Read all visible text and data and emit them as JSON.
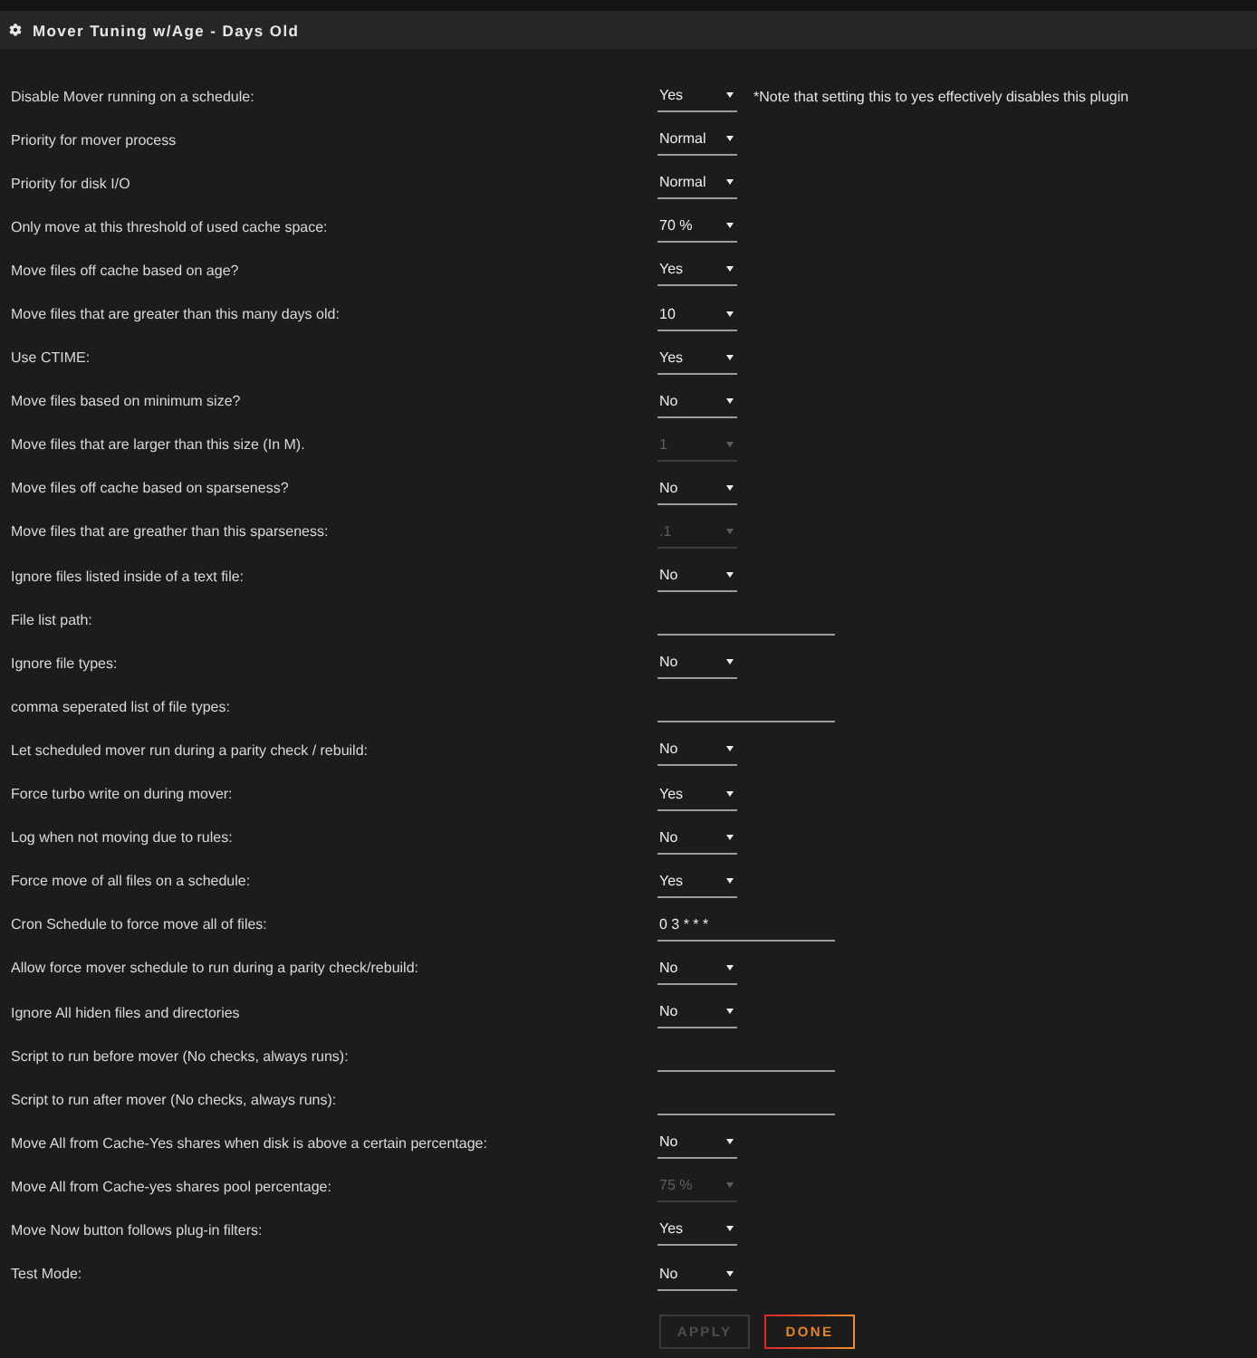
{
  "panel": {
    "title": "Mover Tuning w/Age - Days Old"
  },
  "settings": [
    {
      "label": "Disable Mover running on a schedule:",
      "kind": "select",
      "value": "Yes",
      "disabled": false,
      "note": "*Note that setting this to yes effectively disables this plugin"
    },
    {
      "label": "Priority for mover process",
      "kind": "select",
      "value": "Normal",
      "disabled": false
    },
    {
      "label": "Priority for disk I/O",
      "kind": "select",
      "value": "Normal",
      "disabled": false
    },
    {
      "label": "Only move at this threshold of used cache space:",
      "kind": "select",
      "value": "70 %",
      "disabled": false
    },
    {
      "label": "Move files off cache based on age?",
      "kind": "select",
      "value": "Yes",
      "disabled": false
    },
    {
      "label": "Move files that are greater than this many days old:",
      "kind": "select",
      "value": "10",
      "disabled": false
    },
    {
      "label": "Use CTIME:",
      "kind": "select",
      "value": "Yes",
      "disabled": false
    },
    {
      "label": "Move files based on minimum size?",
      "kind": "select",
      "value": "No",
      "disabled": false
    },
    {
      "label": "Move files that are larger than this size (In M).",
      "kind": "select",
      "value": "1",
      "disabled": true
    },
    {
      "label": "Move files off cache based on sparseness?",
      "kind": "select",
      "value": "No",
      "disabled": false
    },
    {
      "label": "Move files that are greather than this sparseness:",
      "kind": "select",
      "value": ".1",
      "disabled": true
    },
    {
      "label": "Ignore files listed inside of a text file:",
      "kind": "select",
      "value": "No",
      "disabled": false
    },
    {
      "label": "File list path:",
      "kind": "text",
      "disabled": false
    },
    {
      "label": "Ignore file types:",
      "kind": "select",
      "value": "No",
      "disabled": false
    },
    {
      "label": "comma seperated list of file types:",
      "kind": "text",
      "disabled": false
    },
    {
      "label": "Let scheduled mover run during a parity check / rebuild:",
      "kind": "select",
      "value": "No",
      "disabled": false
    },
    {
      "label": "Force turbo write on during mover:",
      "kind": "select",
      "value": "Yes",
      "disabled": false
    },
    {
      "label": "Log when not moving due to rules:",
      "kind": "select",
      "value": "No",
      "disabled": false
    },
    {
      "label": "Force move of all files on a schedule:",
      "kind": "select",
      "value": "Yes",
      "disabled": false
    },
    {
      "label": "Cron Schedule to force move all of files:",
      "kind": "text",
      "value": "0 3 * * *",
      "disabled": false
    },
    {
      "label": "Allow force mover schedule to run during a parity check/rebuild:",
      "kind": "select",
      "value": "No",
      "disabled": false
    },
    {
      "label": "Ignore All hiden files and directories",
      "kind": "select",
      "value": "No",
      "disabled": false
    },
    {
      "label": "Script to run before mover (No checks, always runs):",
      "kind": "text",
      "disabled": false
    },
    {
      "label": "Script to run after mover (No checks, always runs):",
      "kind": "text",
      "disabled": false
    },
    {
      "label": "Move All from Cache-Yes shares when disk is above a certain percentage:",
      "kind": "select",
      "value": "No",
      "disabled": false
    },
    {
      "label": "Move All from Cache-yes shares pool percentage:",
      "kind": "select",
      "value": "75 %",
      "disabled": true
    },
    {
      "label": "Move Now button follows plug-in filters:",
      "kind": "select",
      "value": "Yes",
      "disabled": false
    },
    {
      "label": "Test Mode:",
      "kind": "select",
      "value": "No",
      "disabled": false
    }
  ],
  "buttons": [
    {
      "label": "APPLY",
      "disabled": true
    },
    {
      "label": "DONE",
      "disabled": false
    }
  ]
}
